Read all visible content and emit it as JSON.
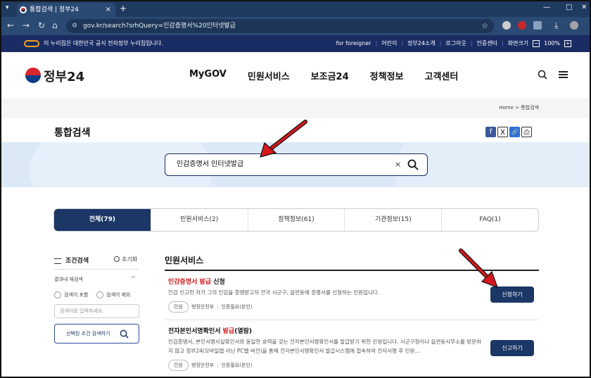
{
  "browser": {
    "tab_title": "통합검색 | 정부24",
    "tab_close": "×",
    "new_tab": "+",
    "menu": "▾",
    "win_min": "—",
    "win_max": "□",
    "win_close": "✕",
    "url": "gov.kr/search?srhQuery=인감증명서%20인터넷발급"
  },
  "govbar": {
    "official_text": "이 누리집은 대한민국 공식 전자정부 누리집입니다.",
    "links": [
      "for foreigner",
      "어린이",
      "정부24소개",
      "로그아웃",
      "인증센터"
    ],
    "zoom_label": "화면크기",
    "zoom_value": "100%",
    "zoom_minus": "−",
    "zoom_plus": "+"
  },
  "header": {
    "logo_text": "정부24",
    "nav": [
      "MyGOV",
      "민원서비스",
      "보조금24",
      "정책정보",
      "고객센터"
    ]
  },
  "breadcrumb": {
    "home": "Home",
    "sep": ">",
    "current": "통합검색"
  },
  "page_title": "통합검색",
  "share": [
    "f",
    "X",
    "🔗",
    "⎙"
  ],
  "search": {
    "value": "인감증명서 인터넷발급",
    "clear": "×"
  },
  "tabs": [
    {
      "label": "전체(79)",
      "active": true
    },
    {
      "label": "민원서비스(2)",
      "active": false
    },
    {
      "label": "정책정보(61)",
      "active": false
    },
    {
      "label": "기관정보(15)",
      "active": false
    },
    {
      "label": "FAQ(1)",
      "active": false
    }
  ],
  "filter": {
    "title": "조건검색",
    "reset": "초기화",
    "within_label": "결과내 재검색",
    "chevron": "^",
    "radio_include": "검색어 포함",
    "radio_exclude": "검색어 제외",
    "placeholder": "검색어를 입력하세요.",
    "submit": "선택된 조건 검색하기"
  },
  "results": {
    "section_title": "민원서비스",
    "items": [
      {
        "title_hl": "인감증명서 발급",
        "title_rest": " 신청",
        "desc": "인감 신고한 자가 그의 인감을 증명받고자 전국 시군구, 읍면동에 증명서를 신청하는 민원입니다.",
        "tag": "민원",
        "agency": "행정안전부",
        "auth": "인증필요(본인)",
        "button": "신청하기"
      },
      {
        "title_pre": "전자본인서명확인서 ",
        "title_hl": "발급",
        "title_rest": "(열람)",
        "desc": "인감증명서, 본인서명사실확인서와 동일한 효력을 갖는 전자본인서명확인서를 발급받기 위한 민원입니다. 시군구청이나 읍면동사무소를 방문하지 않고 정부24(모바일앱 아닌 PC웹 버전)을 통해 전자본인서명확인서 발급시스템에 접속하여 전자서명 후 민원...",
        "tag": "민원",
        "agency": "행정안전부",
        "auth": "인증필요(본인)",
        "button": "신고하기"
      }
    ]
  },
  "colors": {
    "navy": "#1a3766",
    "highlight": "#d0191a",
    "annotation": "#d6181e"
  }
}
